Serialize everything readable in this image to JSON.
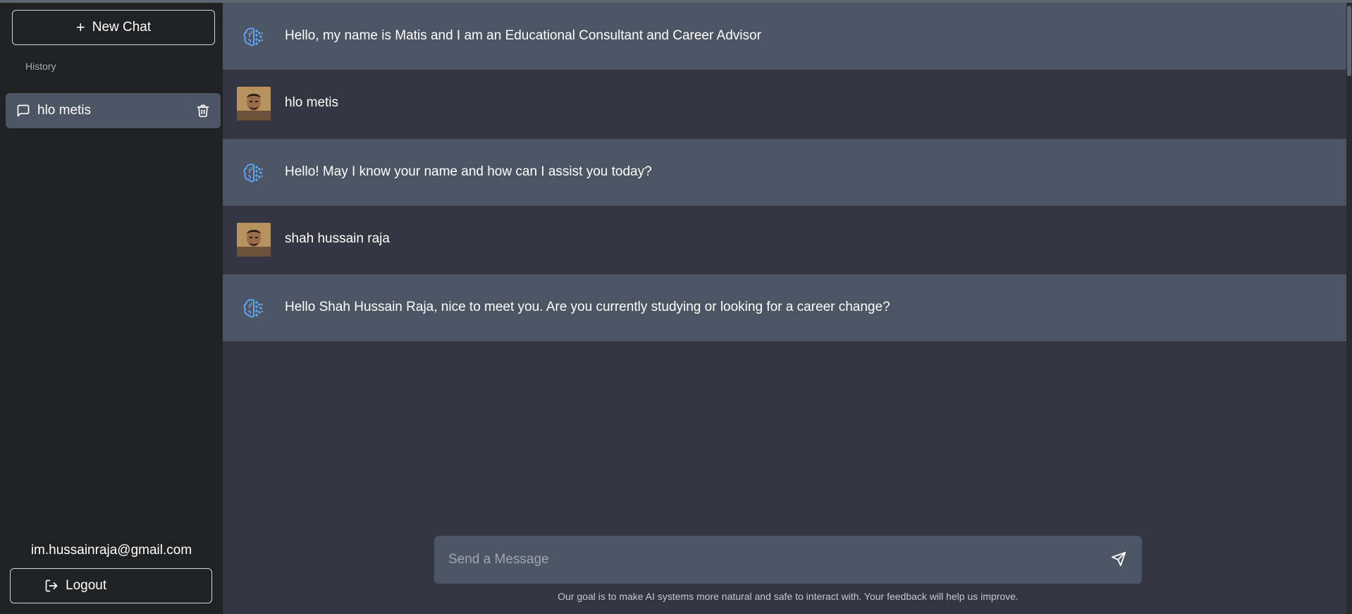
{
  "sidebar": {
    "new_chat_label": "New Chat",
    "history_label": "History",
    "history_items": [
      {
        "label": "hlo metis"
      }
    ],
    "user_email": "im.hussainraja@gmail.com",
    "logout_label": "Logout"
  },
  "messages": [
    {
      "role": "bot",
      "icon": "brain-icon",
      "text": "Hello, my name is Matis and I am an Educational Consultant and Career Advisor"
    },
    {
      "role": "user",
      "icon": "user-avatar",
      "text": "hlo metis"
    },
    {
      "role": "bot",
      "icon": "brain-icon",
      "text": "Hello! May I know your name and how can I assist you today?"
    },
    {
      "role": "user",
      "icon": "user-avatar",
      "text": "shah hussain raja"
    },
    {
      "role": "bot",
      "icon": "brain-icon",
      "text": "Hello Shah Hussain Raja, nice to meet you. Are you currently studying or looking for a career change?"
    }
  ],
  "composer": {
    "placeholder": "Send a Message",
    "value": ""
  },
  "disclaimer": "Our goal is to make AI systems more natural and safe to interact with. Your feedback will help us improve.",
  "colors": {
    "sidebar_bg": "#202123",
    "main_bg": "#343541",
    "bot_row_bg": "#4b5563",
    "accent_icon": "#60a5fa"
  }
}
